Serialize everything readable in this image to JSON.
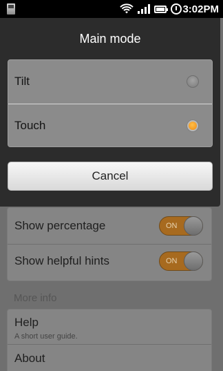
{
  "status_bar": {
    "time": "3:02PM",
    "icons": [
      "sd-card-icon",
      "wifi-icon",
      "signal-icon",
      "battery-icon",
      "alarm-icon"
    ]
  },
  "background_screen": {
    "rows": [
      {
        "label": "Show percentage",
        "toggle": "ON"
      },
      {
        "label": "Show helpful hints",
        "toggle": "ON"
      }
    ],
    "section_header": "More info",
    "items": [
      {
        "title": "Help",
        "subtitle": "A short user guide."
      },
      {
        "title": "About"
      }
    ]
  },
  "dialog": {
    "title": "Main mode",
    "options": [
      {
        "label": "Tilt",
        "selected": false
      },
      {
        "label": "Touch",
        "selected": true
      }
    ],
    "cancel_label": "Cancel"
  },
  "colors": {
    "accent": "#f08a10",
    "dialog_bg": "#2c2c2c",
    "toggle_on": "#a76a1f"
  }
}
